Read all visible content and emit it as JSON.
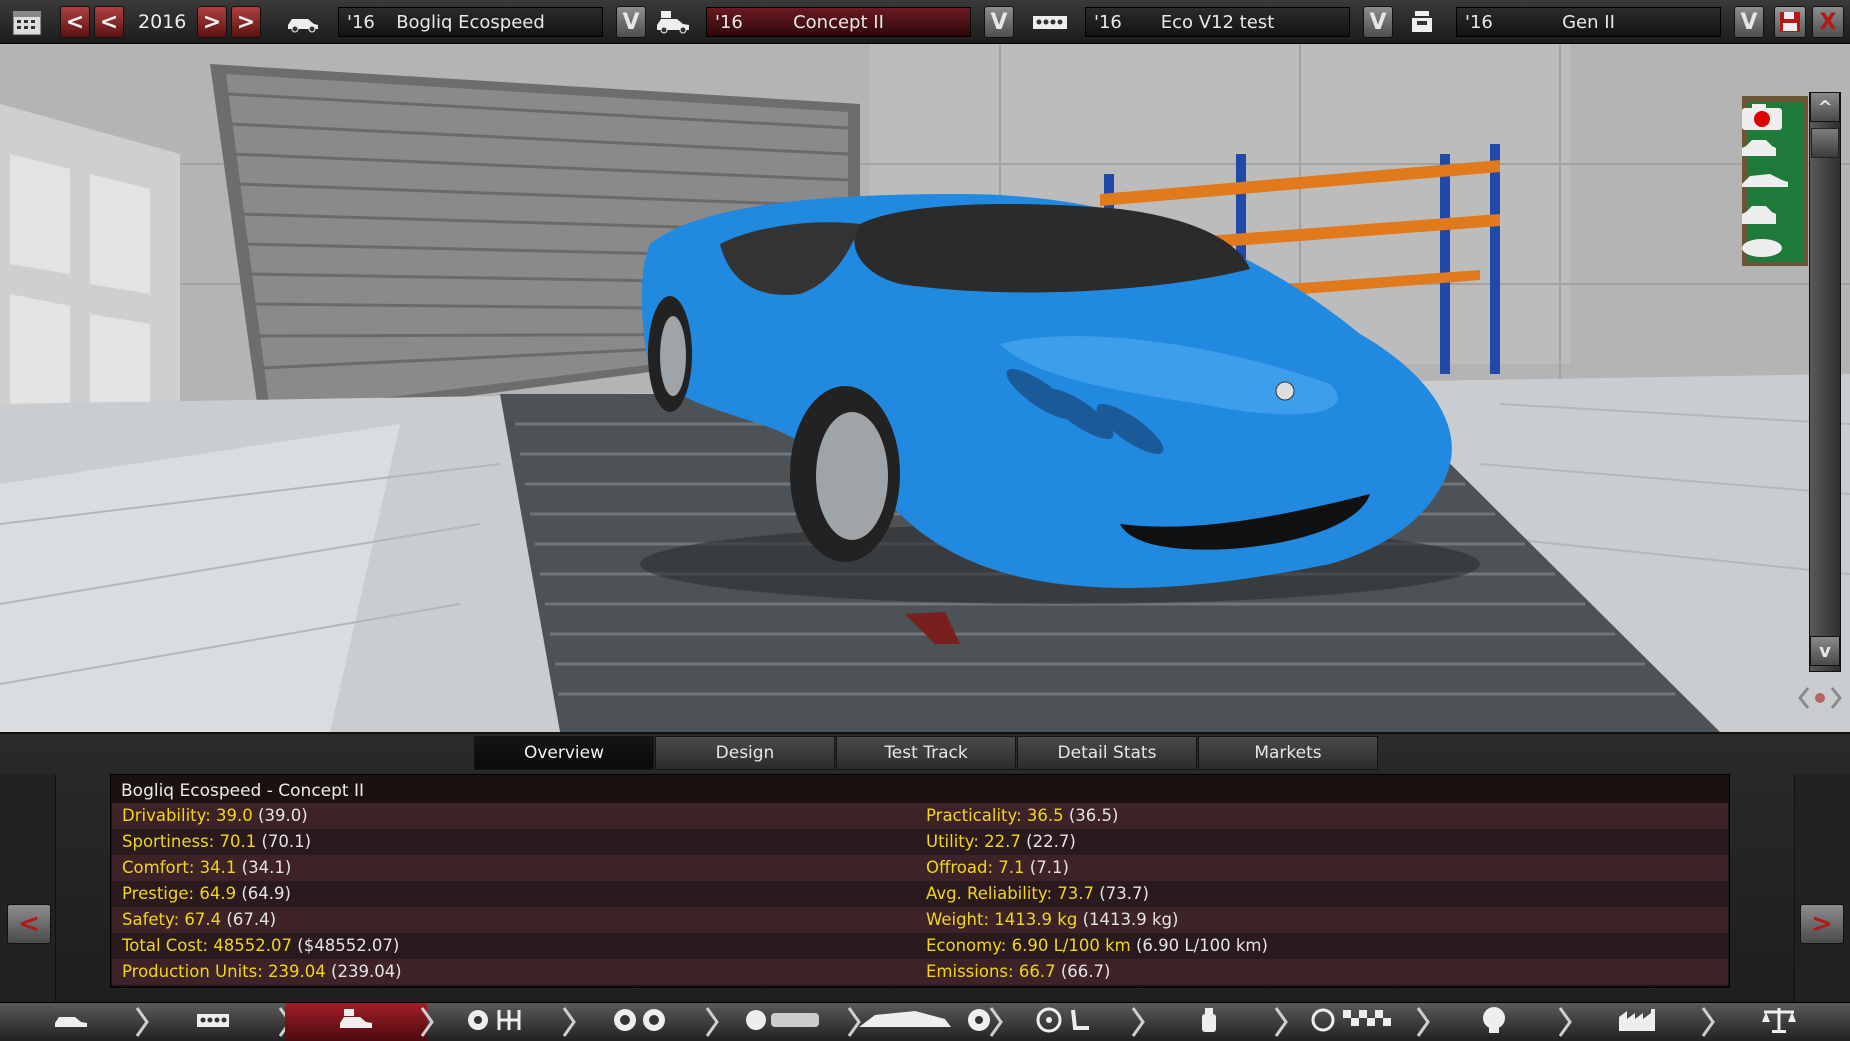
{
  "toolbar": {
    "year": "2016",
    "prev_fast_label": "<",
    "prev_label": "<",
    "next_label": ">",
    "next_fast_label": ">",
    "model": {
      "year": "'16",
      "name": "Bogliq Ecospeed"
    },
    "trim": {
      "year": "'16",
      "name": "Concept II"
    },
    "engine": {
      "year": "'16",
      "name": "Eco V12 test"
    },
    "engine_family": {
      "year": "'16",
      "name": "Gen II"
    },
    "dropdown_label": "V",
    "icons": [
      "calendar-icon",
      "car-model-icon",
      "car-trim-icon",
      "engine-icon",
      "engine-family-icon",
      "save-icon",
      "close-icon"
    ],
    "close_label": "X"
  },
  "viewport": {
    "scroll_up_label": "^",
    "scroll_down_label": "v",
    "camera_buttons": [
      "record-camera-icon",
      "car-front-view-icon",
      "car-side-view-icon",
      "car-rear-view-icon",
      "car-top-view-icon"
    ],
    "car_color": "#2189e0"
  },
  "tabs": [
    "Overview",
    "Design",
    "Test Track",
    "Detail Stats",
    "Markets"
  ],
  "active_tab": "Overview",
  "stats": {
    "title": "Bogliq Ecospeed - Concept II",
    "left": [
      {
        "label": "Drivability:",
        "value": "39.0",
        "prev": "(39.0)"
      },
      {
        "label": "Sportiness:",
        "value": "70.1",
        "prev": "(70.1)"
      },
      {
        "label": "Comfort:",
        "value": "34.1",
        "prev": "(34.1)"
      },
      {
        "label": "Prestige:",
        "value": "64.9",
        "prev": "(64.9)"
      },
      {
        "label": "Safety:",
        "value": "67.4",
        "prev": "(67.4)"
      },
      {
        "label": "Total Cost:",
        "value": "48552.07",
        "prev": "($48552.07)"
      },
      {
        "label": "Production Units:",
        "value": "239.04",
        "prev": "(239.04)"
      }
    ],
    "right": [
      {
        "label": "Practicality:",
        "value": "36.5",
        "prev": "(36.5)"
      },
      {
        "label": "Utility:",
        "value": "22.7",
        "prev": "(22.7)"
      },
      {
        "label": "Offroad:",
        "value": "7.1",
        "prev": "(7.1)"
      },
      {
        "label": "Avg. Reliability:",
        "value": "73.7",
        "prev": "(73.7)"
      },
      {
        "label": "Weight:",
        "value": "1413.9 kg",
        "prev": "(1413.9 kg)"
      },
      {
        "label": "Economy:",
        "value": "6.90 L/100 km",
        "prev": "(6.90 L/100 km)"
      },
      {
        "label": "Emissions:",
        "value": "66.7",
        "prev": "(66.7)"
      }
    ],
    "label_color": "#f0d51a"
  },
  "side_nav": {
    "prev_label": "<",
    "next_label": ">"
  },
  "bottom_nav": [
    {
      "name": "car-model-nav",
      "icon": "car-model-icon"
    },
    {
      "name": "engine-nav",
      "icon": "engine-icon"
    },
    {
      "name": "car-trim-nav",
      "icon": "car-trim-icon",
      "active": true
    },
    {
      "name": "drivetrain-nav",
      "icon": "gearbox-icon"
    },
    {
      "name": "suspension-nav",
      "icon": "wheels-icon"
    },
    {
      "name": "body-nav",
      "icon": "chassis-icon"
    },
    {
      "name": "design-nav",
      "icon": "car-body-icon"
    },
    {
      "name": "interior-nav",
      "icon": "steering-wheel-icon"
    },
    {
      "name": "fixture-nav",
      "icon": "spray-icon"
    },
    {
      "name": "testing-nav",
      "icon": "test-track-icon"
    },
    {
      "name": "research-nav",
      "icon": "research-icon"
    },
    {
      "name": "factory-nav",
      "icon": "factory-icon"
    },
    {
      "name": "balance-nav",
      "icon": "balance-icon"
    }
  ],
  "colors": {
    "active_red": "#a01e26",
    "panel_bg": "#1b1111",
    "row_odd": "#3d2328",
    "row_even": "#2b1a1d"
  }
}
